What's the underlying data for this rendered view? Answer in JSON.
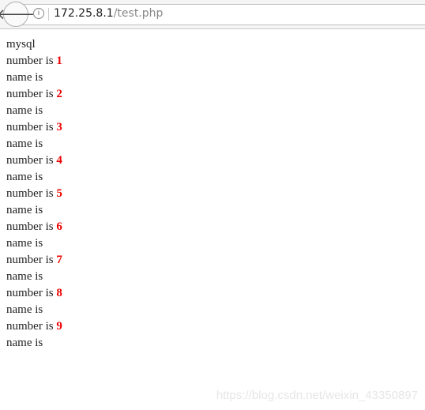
{
  "browser": {
    "url_host": "172.25.8.1",
    "url_path": "/test.php",
    "back_icon": "arrow-left-icon",
    "info_icon": "info-icon"
  },
  "content": {
    "header": "mysql",
    "number_prefix": "number is ",
    "name_label": "name is",
    "numbers": [
      "1",
      "2",
      "3",
      "4",
      "5",
      "6",
      "7",
      "8",
      "9"
    ],
    "number_color": "#e00000"
  },
  "watermark": "https://blog.csdn.net/weixin_43350897"
}
